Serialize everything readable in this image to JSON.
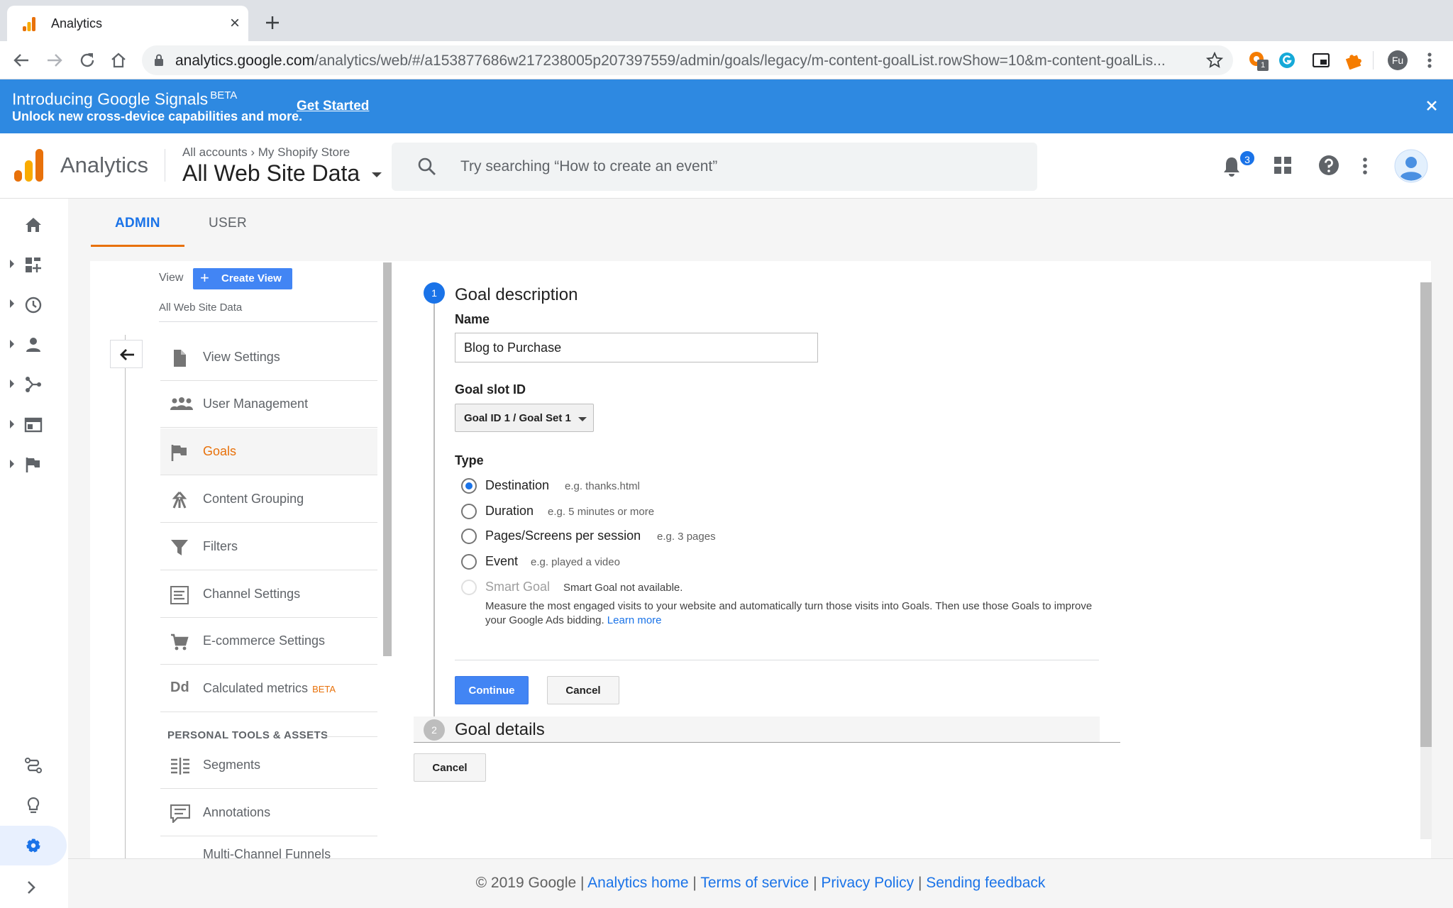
{
  "browser": {
    "tab_title": "Analytics",
    "url_host": "analytics.google.com",
    "url_path": "/analytics/web/#/a153877686w217238005p207397559/admin/goals/legacy/m-content-goalList.rowShow=10&m-content-goalLis...",
    "profile_initials": "Fu",
    "extension_badge": "1"
  },
  "banner": {
    "title": "Introducing Google Signals",
    "beta": "BETA",
    "subtitle": "Unlock new cross-device capabilities and more.",
    "link": "Get Started"
  },
  "header": {
    "app_name": "Analytics",
    "breadcrumb": "All accounts  ›  My Shopify Store",
    "property": "All Web Site Data",
    "search_placeholder": "Try searching “How to create an event”",
    "notification_count": "3"
  },
  "tabs": {
    "admin": "ADMIN",
    "user": "USER"
  },
  "view_column": {
    "label": "View",
    "create_button": "Create View",
    "view_name": "All Web Site Data",
    "items": [
      {
        "label": "View Settings",
        "icon": "file-icon"
      },
      {
        "label": "User Management",
        "icon": "people-icon"
      },
      {
        "label": "Goals",
        "icon": "flag-icon"
      },
      {
        "label": "Content Grouping",
        "icon": "content-grouping-icon"
      },
      {
        "label": "Filters",
        "icon": "filter-icon"
      },
      {
        "label": "Channel Settings",
        "icon": "channel-settings-icon"
      },
      {
        "label": "E-commerce Settings",
        "icon": "cart-icon"
      },
      {
        "label": "Calculated metrics",
        "icon": "dd-icon",
        "badge": "BETA"
      }
    ],
    "section_header": "PERSONAL TOOLS & ASSETS",
    "personal_items": [
      {
        "label": "Segments",
        "icon": "segments-icon"
      },
      {
        "label": "Annotations",
        "icon": "annotations-icon"
      },
      {
        "label": "Multi-Channel Funnels",
        "icon": "funnel-icon"
      }
    ]
  },
  "goal_form": {
    "step1_number": "1",
    "step1_title": "Goal description",
    "name_label": "Name",
    "name_value": "Blog to Purchase",
    "slot_label": "Goal slot ID",
    "slot_value": "Goal ID 1 / Goal Set 1",
    "type_label": "Type",
    "types": [
      {
        "label": "Destination",
        "example": "e.g. thanks.html",
        "selected": true
      },
      {
        "label": "Duration",
        "example": "e.g. 5 minutes or more",
        "selected": false
      },
      {
        "label": "Pages/Screens per session",
        "example": "e.g. 3 pages",
        "selected": false
      },
      {
        "label": "Event",
        "example": "e.g. played a video",
        "selected": false
      },
      {
        "label": "Smart Goal",
        "example": "Smart Goal not available.",
        "selected": false,
        "disabled": true
      }
    ],
    "smart_desc": "Measure the most engaged visits to your website and automatically turn those visits into Goals. Then use those Goals to improve your Google Ads bidding.",
    "learn_more": "Learn more",
    "continue": "Continue",
    "cancel": "Cancel",
    "step2_number": "2",
    "step2_title": "Goal details",
    "cancel_bottom": "Cancel"
  },
  "footer": {
    "copyright": "© 2019 Google",
    "links": [
      "Analytics home",
      "Terms of service",
      "Privacy Policy",
      "Sending feedback"
    ],
    "separator": "|"
  },
  "colors": {
    "accent": "#1a73e8",
    "banner": "#2e89e1",
    "active_orange": "#e8710a",
    "button_blue": "#4285f4"
  }
}
